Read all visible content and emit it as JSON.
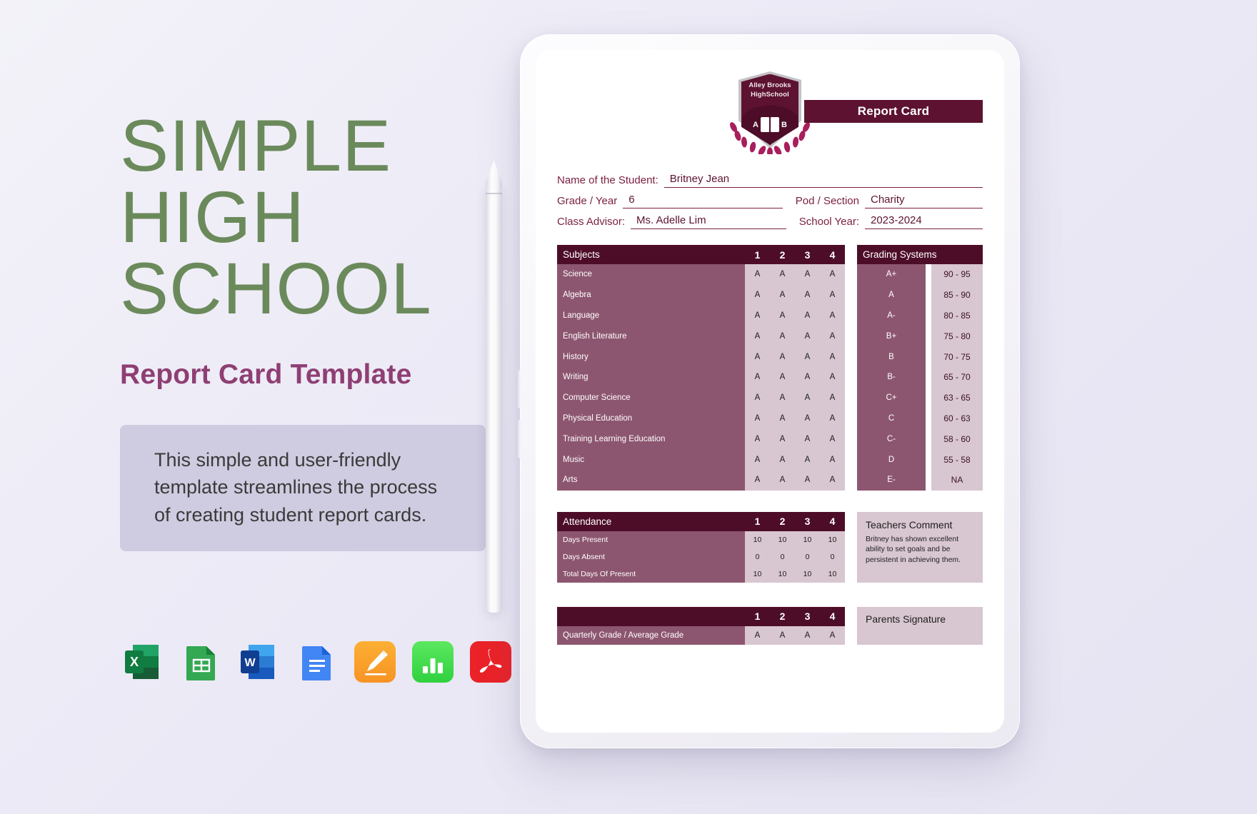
{
  "promo": {
    "title_lines": [
      "SIMPLE",
      "HIGH",
      "SCHOOL"
    ],
    "subtitle": "Report Card Template",
    "description": "This simple and user-friendly template streamlines the process of creating student report cards.",
    "format_icons": [
      {
        "name": "excel-icon",
        "label": "Microsoft Excel"
      },
      {
        "name": "google-sheets-icon",
        "label": "Google Sheets"
      },
      {
        "name": "word-icon",
        "label": "Microsoft Word"
      },
      {
        "name": "google-docs-icon",
        "label": "Google Docs"
      },
      {
        "name": "apple-pages-icon",
        "label": "Apple Pages"
      },
      {
        "name": "apple-numbers-icon",
        "label": "Apple Numbers"
      },
      {
        "name": "pdf-icon",
        "label": "PDF"
      }
    ]
  },
  "report_card": {
    "logo": {
      "line1": "Alley Brooks",
      "line2": "HighSchool",
      "left_letter": "A",
      "right_letter": "B"
    },
    "badge_label": "Report Card",
    "info": {
      "name_label": "Name of the Student:",
      "name_value": "Britney Jean",
      "grade_label": "Grade / Year",
      "grade_value": "6",
      "pod_label": "Pod / Section",
      "pod_value": "Charity",
      "advisor_label": "Class Advisor:",
      "advisor_value": "Ms. Adelle Lim",
      "school_year_label": "School Year:",
      "school_year_value": "2023-2024"
    },
    "subjects_table": {
      "header": "Subjects",
      "quarters": [
        "1",
        "2",
        "3",
        "4"
      ],
      "rows": [
        {
          "subject": "Science",
          "grades": [
            "A",
            "A",
            "A",
            "A"
          ]
        },
        {
          "subject": "Algebra",
          "grades": [
            "A",
            "A",
            "A",
            "A"
          ]
        },
        {
          "subject": "Language",
          "grades": [
            "A",
            "A",
            "A",
            "A"
          ]
        },
        {
          "subject": "English Literature",
          "grades": [
            "A",
            "A",
            "A",
            "A"
          ]
        },
        {
          "subject": "History",
          "grades": [
            "A",
            "A",
            "A",
            "A"
          ]
        },
        {
          "subject": "Writing",
          "grades": [
            "A",
            "A",
            "A",
            "A"
          ]
        },
        {
          "subject": "Computer Science",
          "grades": [
            "A",
            "A",
            "A",
            "A"
          ]
        },
        {
          "subject": "Physical Education",
          "grades": [
            "A",
            "A",
            "A",
            "A"
          ]
        },
        {
          "subject": "Training Learning Education",
          "grades": [
            "A",
            "A",
            "A",
            "A"
          ]
        },
        {
          "subject": "Music",
          "grades": [
            "A",
            "A",
            "A",
            "A"
          ]
        },
        {
          "subject": "Arts",
          "grades": [
            "A",
            "A",
            "A",
            "A"
          ]
        }
      ]
    },
    "grading_table": {
      "header": "Grading Systems",
      "rows": [
        {
          "letter": "A+",
          "range": "90 - 95"
        },
        {
          "letter": "A",
          "range": "85 - 90"
        },
        {
          "letter": "A-",
          "range": "80 - 85"
        },
        {
          "letter": "B+",
          "range": "75 - 80"
        },
        {
          "letter": "B",
          "range": "70 - 75"
        },
        {
          "letter": "B-",
          "range": "65 - 70"
        },
        {
          "letter": "C+",
          "range": "63 - 65"
        },
        {
          "letter": "C",
          "range": "60 - 63"
        },
        {
          "letter": "C-",
          "range": "58 - 60"
        },
        {
          "letter": "D",
          "range": "55 - 58"
        },
        {
          "letter": "E-",
          "range": "NA"
        }
      ]
    },
    "attendance_table": {
      "header": "Attendance",
      "quarters": [
        "1",
        "2",
        "3",
        "4"
      ],
      "rows": [
        {
          "label": "Days Present",
          "values": [
            "10",
            "10",
            "10",
            "10"
          ]
        },
        {
          "label": "Days Absent",
          "values": [
            "0",
            "0",
            "0",
            "0"
          ]
        },
        {
          "label": "Total Days Of Present",
          "values": [
            "10",
            "10",
            "10",
            "10"
          ]
        }
      ]
    },
    "teachers_comment": {
      "title": "Teachers Comment",
      "text": "Britney has shown excellent ability to set goals and be persistent in achieving them."
    },
    "quarterly_table": {
      "header": "",
      "quarters": [
        "1",
        "2",
        "3",
        "4"
      ],
      "rows": [
        {
          "label": "Quarterly Grade / Average Grade",
          "values": [
            "A",
            "A",
            "A",
            "A"
          ]
        }
      ]
    },
    "parents_signature": {
      "title": "Parents Signature"
    }
  },
  "colors": {
    "deep_maroon": "#4d0d28",
    "maroon": "#5d1231",
    "mauve": "#8d5670",
    "pink_light": "#d8c6d0",
    "green": "#6b8a5b",
    "purple": "#8e3f74",
    "lavender_box": "#cfcbe0"
  }
}
